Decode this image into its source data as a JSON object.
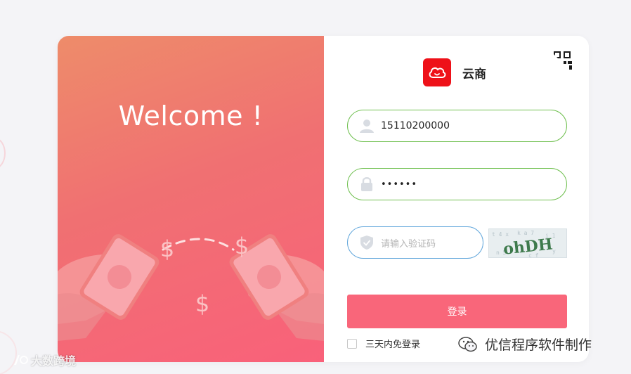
{
  "welcome_title": "Welcome !",
  "brand": {
    "name": "云商",
    "logo_icon": "cloud-smile-icon",
    "logo_color": "#ee1119"
  },
  "qr_toggle_icon": "qr-code-icon",
  "form": {
    "username": {
      "value": "15110200000",
      "icon": "user-icon"
    },
    "password": {
      "value": "••••••",
      "icon": "lock-icon"
    },
    "captcha": {
      "placeholder": "请输入验证码",
      "icon": "shield-icon",
      "image_text": "ohDH"
    },
    "login_label": "登录",
    "remember_label": "三天内免登录"
  },
  "illustration": {
    "currency_symbol": "$"
  },
  "watermarks": {
    "left": "大数跨境",
    "right": "优信程序软件制作"
  },
  "colors": {
    "accent": "#f9667a",
    "field_border": "#70c050",
    "captcha_border": "#64a8dc",
    "panel_gradient_start": "#ee8c6a",
    "panel_gradient_end": "#f9617a"
  }
}
